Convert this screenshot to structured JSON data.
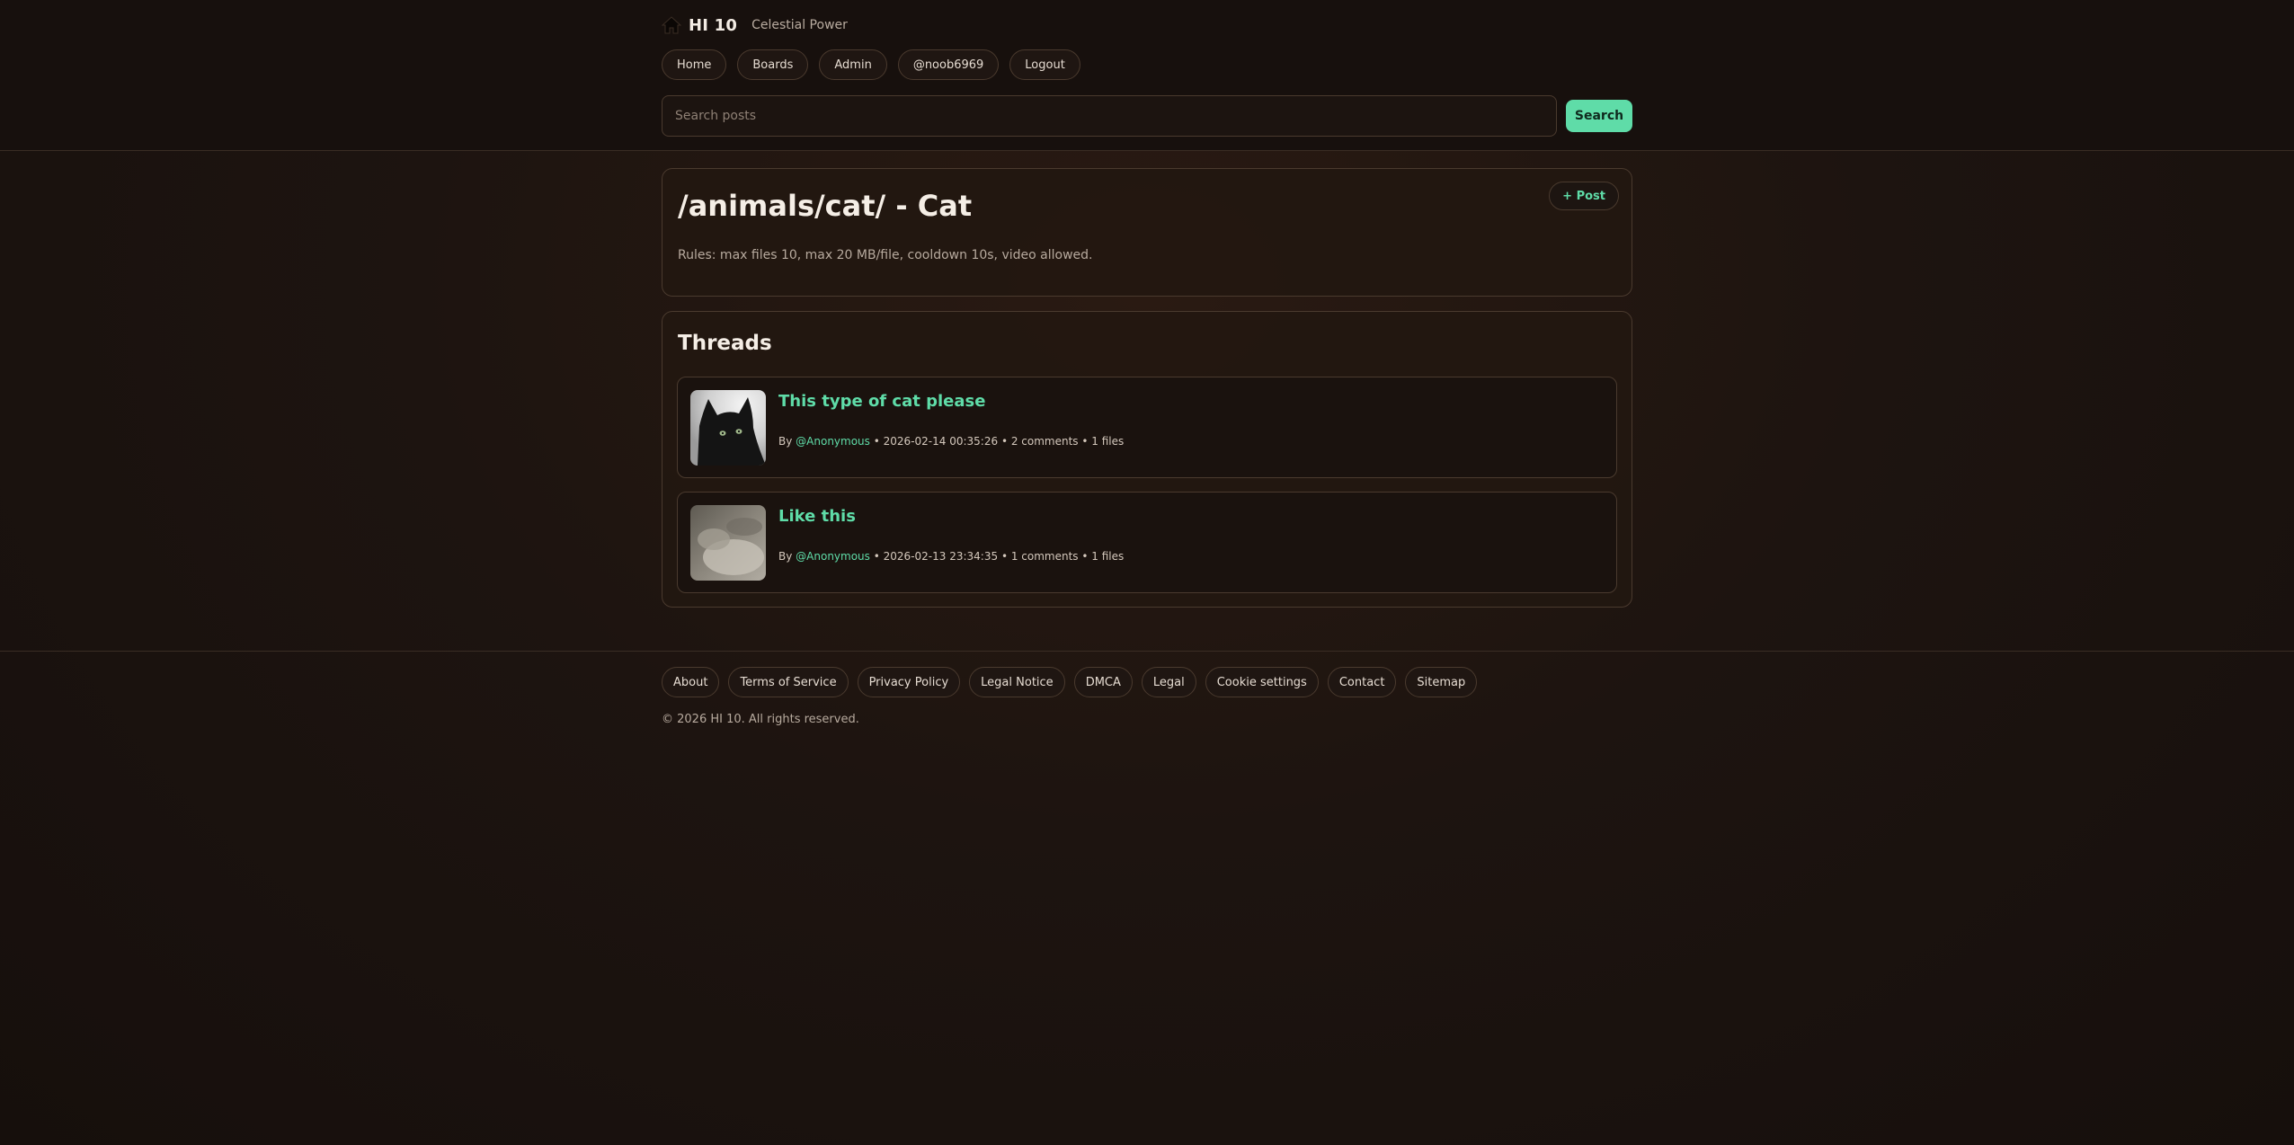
{
  "brand": {
    "name": "HI 10",
    "tagline": "Celestial Power"
  },
  "nav": {
    "items": [
      "Home",
      "Boards",
      "Admin",
      "@noob6969",
      "Logout"
    ]
  },
  "search": {
    "placeholder": "Search posts",
    "value": "",
    "button_label": "Search"
  },
  "board": {
    "title": "/animals/cat/ - Cat",
    "rules": "Rules: max files 10, max 20 MB/file, cooldown 10s, video allowed.",
    "post_button_label": "+ Post"
  },
  "threads": {
    "heading": "Threads",
    "items": [
      {
        "title": "This type of cat please",
        "by_label": "By",
        "author": "@Anonymous",
        "date": "2026-02-14 00:35:26",
        "comments": "2 comments",
        "files": "1 files",
        "thumbnail": "black-cat-photo"
      },
      {
        "title": "Like this",
        "by_label": "By",
        "author": "@Anonymous",
        "date": "2026-02-13 23:34:35",
        "comments": "1 comments",
        "files": "1 files",
        "thumbnail": "grey-cat-photo"
      }
    ]
  },
  "footer": {
    "links": [
      "About",
      "Terms of Service",
      "Privacy Policy",
      "Legal Notice",
      "DMCA",
      "Legal",
      "Cookie settings",
      "Contact",
      "Sitemap"
    ],
    "copyright": "© 2026 HI 10. All rights reserved."
  },
  "colors": {
    "accent": "#5fdca8",
    "background": "#1a1210",
    "border": "#4a3a2e"
  },
  "icons": {
    "home": "home-icon"
  }
}
